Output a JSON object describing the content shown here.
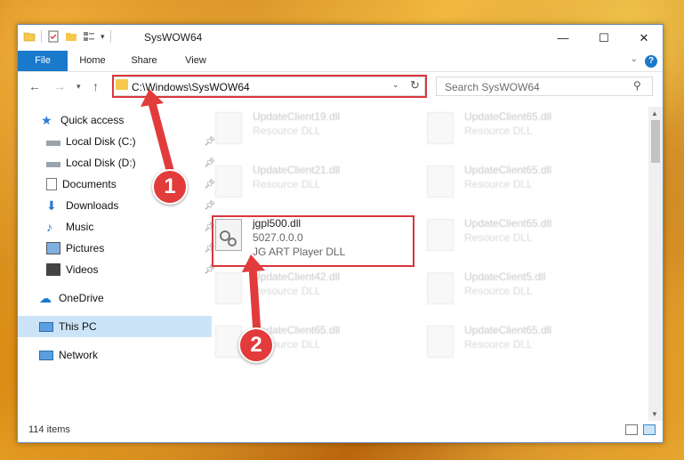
{
  "window": {
    "title": "SysWOW64",
    "controls": {
      "minimize": "—",
      "maximize": "☐",
      "close": "✕"
    }
  },
  "ribbon": {
    "tabs": [
      "File",
      "Home",
      "Share",
      "View"
    ],
    "help": "?"
  },
  "address": {
    "path": "C:\\Windows\\SysWOW64",
    "search_placeholder": "Search SysWOW64"
  },
  "nav_pane": {
    "items": [
      {
        "label": "Quick access",
        "icon": "star-icon"
      },
      {
        "label": "Local Disk (C:)",
        "icon": "drive-icon",
        "pinned": true
      },
      {
        "label": "Local Disk (D:)",
        "icon": "drive-icon",
        "pinned": true
      },
      {
        "label": "Documents",
        "icon": "documents-icon",
        "pinned": true
      },
      {
        "label": "Downloads",
        "icon": "downloads-icon",
        "pinned": true
      },
      {
        "label": "Music",
        "icon": "music-icon",
        "pinned": true
      },
      {
        "label": "Pictures",
        "icon": "pictures-icon",
        "pinned": true
      },
      {
        "label": "Videos",
        "icon": "videos-icon",
        "pinned": true
      },
      {
        "label": "OneDrive",
        "icon": "cloud-icon"
      },
      {
        "label": "This PC",
        "icon": "computer-icon",
        "selected": true
      },
      {
        "label": "Network",
        "icon": "network-icon"
      }
    ]
  },
  "files": [
    {
      "name": "UpdateClient19.dll",
      "type": "Resource DLL"
    },
    {
      "name": "UpdateClient65.dll",
      "type": "Resource DLL"
    },
    {
      "name": "UpdateClient21.dll",
      "type": "Resource DLL"
    },
    {
      "name": "UpdateClient65.dll",
      "type": "Resource DLL"
    },
    {
      "name": "jgpl500.dll",
      "version": "5027.0.0.0",
      "type": "JG ART Player DLL",
      "highlighted": true
    },
    {
      "name": "UpdateClient65.dll",
      "type": "Resource DLL"
    },
    {
      "name": "UpdateClient42.dll",
      "type": "Resource DLL"
    },
    {
      "name": "UpdateClient5.dll",
      "type": "Resource DLL"
    },
    {
      "name": "UpdateClient65.dll",
      "type": "Resource DLL"
    },
    {
      "name": "UpdateClient65.dll",
      "type": "Resource DLL"
    }
  ],
  "status": {
    "item_count": "114 items"
  },
  "annotations": [
    "1",
    "2"
  ],
  "colors": {
    "accent": "#1979ca",
    "highlight": "#d9363e",
    "selected": "#cce4f7"
  }
}
